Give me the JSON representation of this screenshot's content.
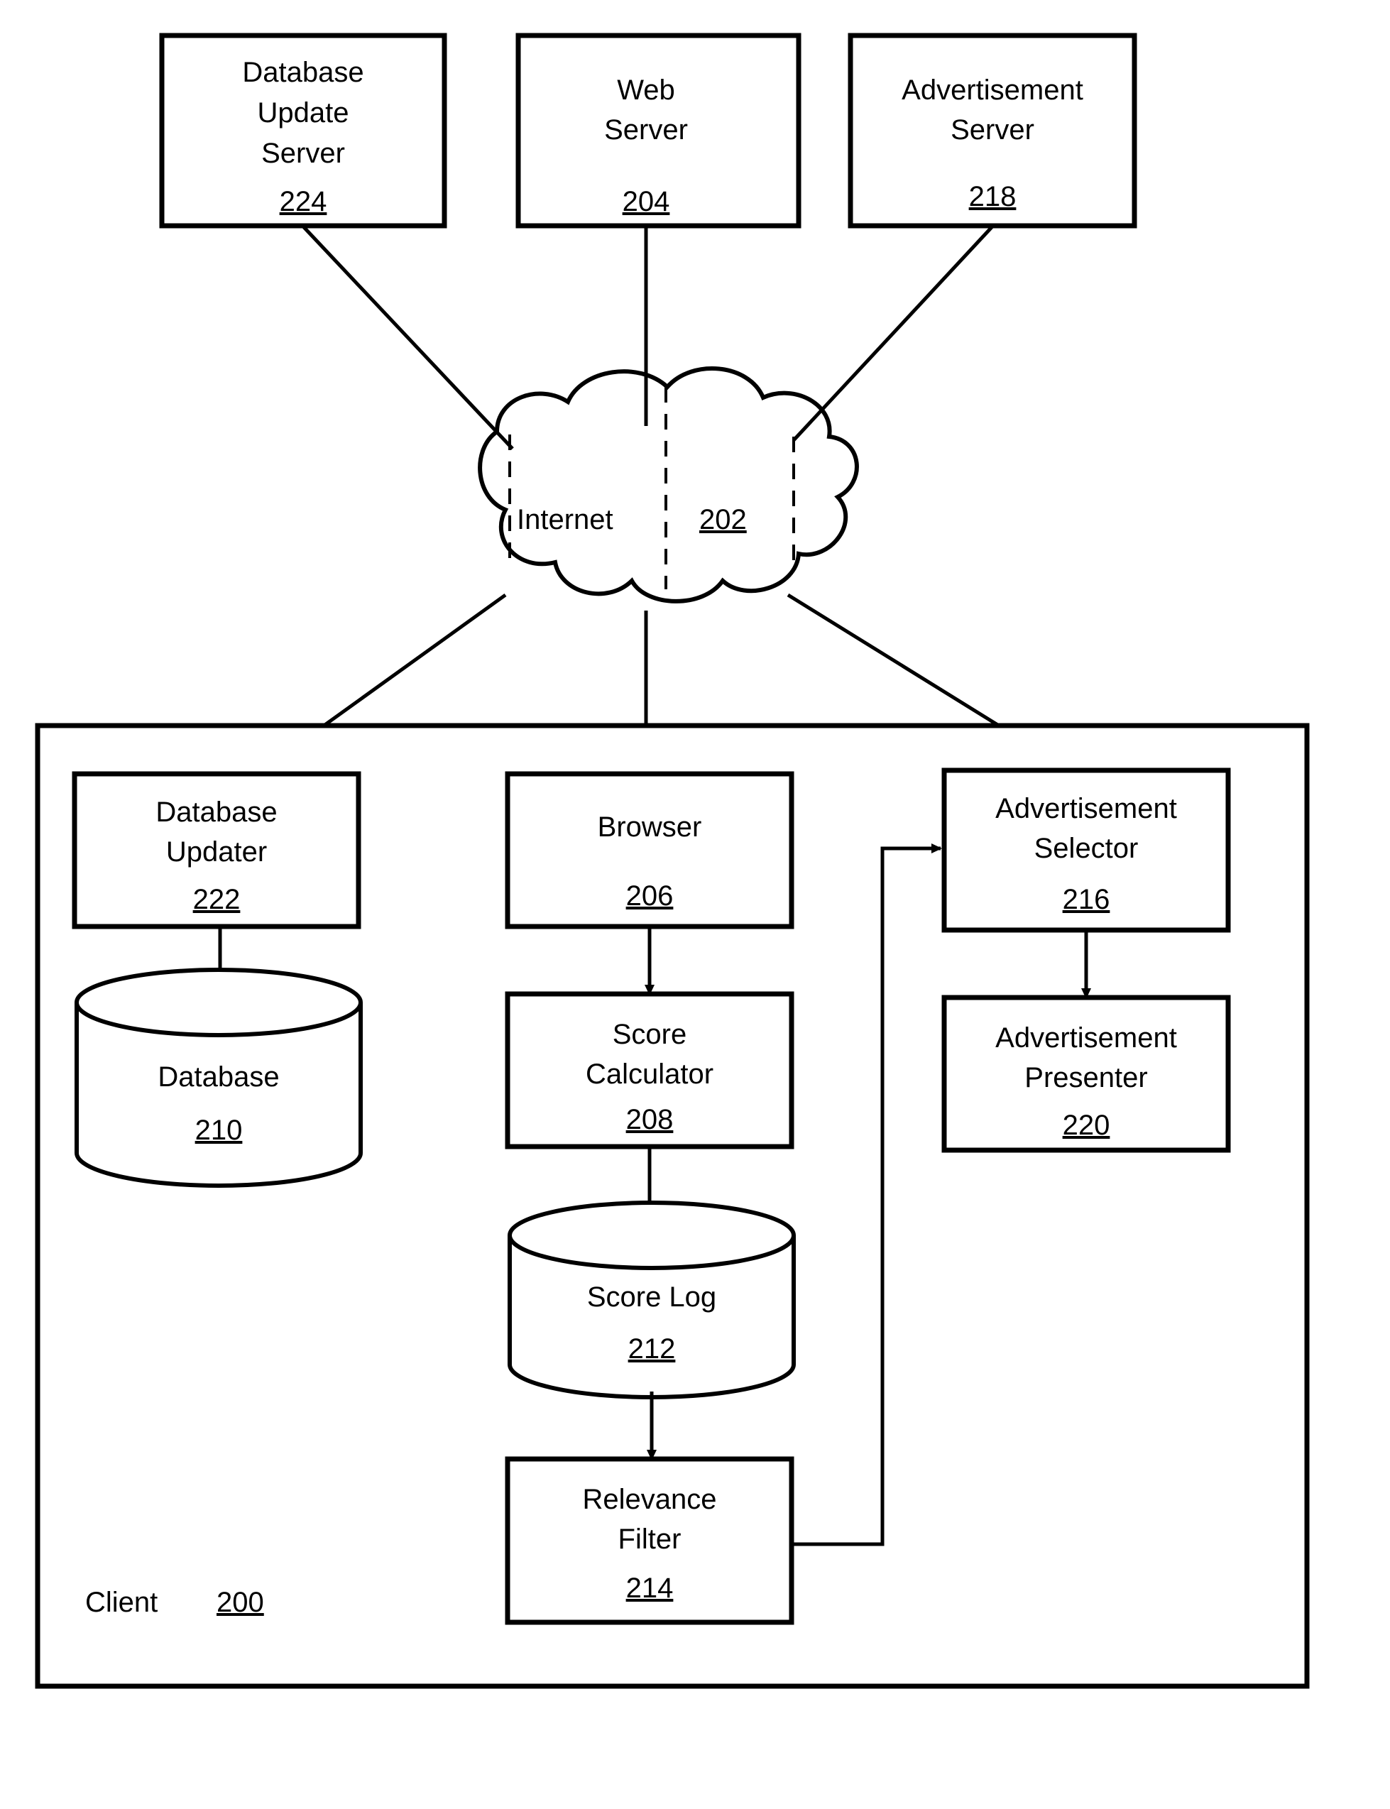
{
  "figure": {
    "type": "patent-block-diagram",
    "background": "#ffffff",
    "stroke_color": "#000000"
  },
  "network": {
    "cloud_label": "Internet",
    "cloud_ref": "202"
  },
  "servers": [
    {
      "id": "db-update-server",
      "label_lines": [
        "Database",
        "Update",
        "Server"
      ],
      "ref": "224"
    },
    {
      "id": "web-server",
      "label_lines": [
        "Web",
        "Server"
      ],
      "ref": "204"
    },
    {
      "id": "ad-server",
      "label_lines": [
        "Advertisement",
        "Server"
      ],
      "ref": "218"
    }
  ],
  "client": {
    "label": "Client",
    "ref": "200",
    "components": [
      {
        "id": "database-updater",
        "label_lines": [
          "Database",
          "Updater"
        ],
        "ref": "222",
        "shape": "box"
      },
      {
        "id": "database",
        "label_lines": [
          "Database"
        ],
        "ref": "210",
        "shape": "cylinder"
      },
      {
        "id": "browser",
        "label_lines": [
          "Browser"
        ],
        "ref": "206",
        "shape": "box"
      },
      {
        "id": "score-calculator",
        "label_lines": [
          "Score",
          "Calculator"
        ],
        "ref": "208",
        "shape": "box"
      },
      {
        "id": "score-log",
        "label_lines": [
          "Score Log"
        ],
        "ref": "212",
        "shape": "cylinder"
      },
      {
        "id": "relevance-filter",
        "label_lines": [
          "Relevance",
          "Filter"
        ],
        "ref": "214",
        "shape": "box"
      },
      {
        "id": "ad-selector",
        "label_lines": [
          "Advertisement",
          "Selector"
        ],
        "ref": "216",
        "shape": "box"
      },
      {
        "id": "ad-presenter",
        "label_lines": [
          "Advertisement",
          "Presenter"
        ],
        "ref": "220",
        "shape": "box"
      }
    ]
  },
  "labels": {
    "db_update_server_l1": "Database",
    "db_update_server_l2": "Update",
    "db_update_server_l3": "Server",
    "db_update_server_ref": "224",
    "web_server_l1": "Web",
    "web_server_l2": "Server",
    "web_server_ref": "204",
    "ad_server_l1": "Advertisement",
    "ad_server_l2": "Server",
    "ad_server_ref": "218",
    "internet": "Internet",
    "internet_ref": "202",
    "database_updater_l1": "Database",
    "database_updater_l2": "Updater",
    "database_updater_ref": "222",
    "database_l1": "Database",
    "database_ref": "210",
    "browser_l1": "Browser",
    "browser_ref": "206",
    "score_calculator_l1": "Score",
    "score_calculator_l2": "Calculator",
    "score_calculator_ref": "208",
    "score_log_l1": "Score Log",
    "score_log_ref": "212",
    "relevance_filter_l1": "Relevance",
    "relevance_filter_l2": "Filter",
    "relevance_filter_ref": "214",
    "ad_selector_l1": "Advertisement",
    "ad_selector_l2": "Selector",
    "ad_selector_ref": "216",
    "ad_presenter_l1": "Advertisement",
    "ad_presenter_l2": "Presenter",
    "ad_presenter_ref": "220",
    "client": "Client",
    "client_ref": "200"
  },
  "connections": [
    {
      "from": "db-update-server",
      "to": "internet-cloud",
      "style": "plain-line"
    },
    {
      "from": "web-server",
      "to": "internet-cloud",
      "style": "plain-line"
    },
    {
      "from": "ad-server",
      "to": "internet-cloud",
      "style": "plain-line"
    },
    {
      "from": "internet-cloud",
      "to": "database-updater",
      "style": "plain-line"
    },
    {
      "from": "internet-cloud",
      "to": "browser",
      "style": "plain-line"
    },
    {
      "from": "internet-cloud",
      "to": "ad-selector",
      "style": "plain-line"
    },
    {
      "from": "database-updater",
      "to": "database",
      "style": "arrow"
    },
    {
      "from": "browser",
      "to": "score-calculator",
      "style": "arrow"
    },
    {
      "from": "score-calculator",
      "to": "score-log",
      "style": "arrow"
    },
    {
      "from": "score-log",
      "to": "relevance-filter",
      "style": "arrow"
    },
    {
      "from": "relevance-filter",
      "to": "ad-selector",
      "style": "arrow-elbow"
    },
    {
      "from": "ad-selector",
      "to": "ad-presenter",
      "style": "arrow"
    }
  ]
}
